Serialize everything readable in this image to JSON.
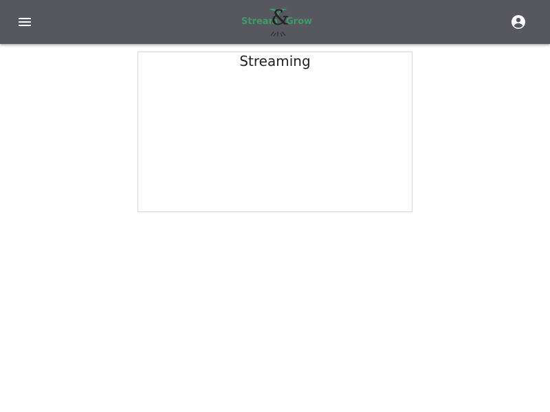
{
  "appbar": {
    "menu_icon": "menu-icon",
    "account_icon": "account-circle-icon",
    "logo": {
      "left_text": "Stream",
      "amp": "&",
      "right_text": "Grow"
    }
  },
  "colors": {
    "appbar_background": "#57575f",
    "logo_green": "#3f9a6a",
    "card_border": "#d7d7d7",
    "text": "#222222"
  },
  "card": {
    "title": "Streaming"
  }
}
